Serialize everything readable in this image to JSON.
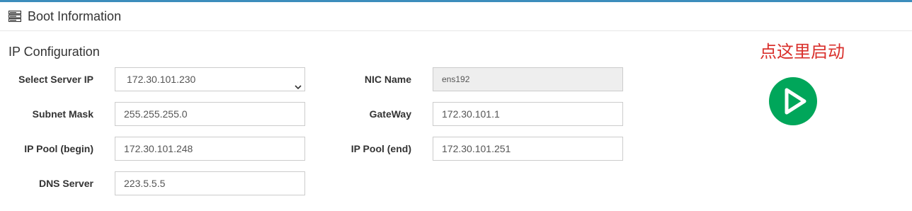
{
  "header": {
    "title": "Boot Information",
    "icon": "server-icon"
  },
  "section": {
    "title": "IP Configuration"
  },
  "fields": {
    "server_ip": {
      "label": "Select Server IP",
      "value": "172.30.101.230"
    },
    "nic_name": {
      "label": "NIC Name",
      "value": "ens192"
    },
    "subnet_mask": {
      "label": "Subnet Mask",
      "value": "255.255.255.0"
    },
    "gateway": {
      "label": "GateWay",
      "value": "172.30.101.1"
    },
    "pool_begin": {
      "label": "IP Pool (begin)",
      "value": "172.30.101.248"
    },
    "pool_end": {
      "label": "IP Pool (end)",
      "value": "172.30.101.251"
    },
    "dns_server": {
      "label": "DNS Server",
      "value": "223.5.5.5"
    }
  },
  "start": {
    "label": "点这里启动",
    "icon": "play-icon",
    "color": "#00a65a"
  },
  "colors": {
    "accent": "#3c8dbc",
    "start_label": "#d9302c"
  }
}
